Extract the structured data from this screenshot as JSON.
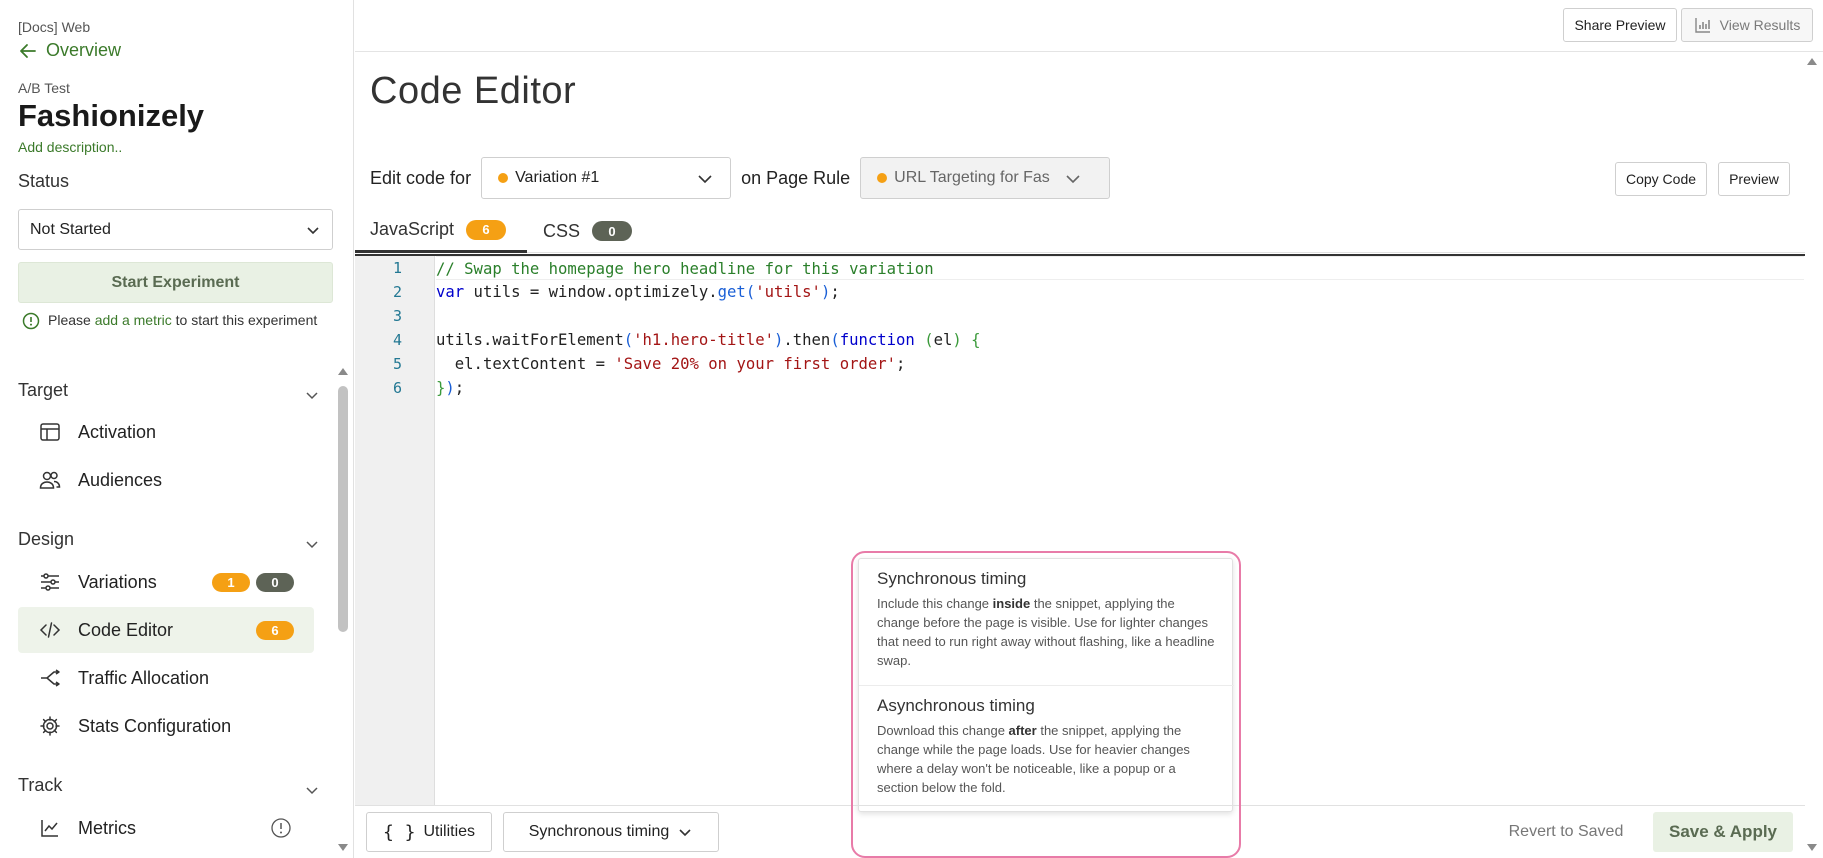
{
  "sidebar": {
    "breadcrumb": "[Docs] Web",
    "back_label": "Overview",
    "experiment_type": "A/B Test",
    "experiment_name": "Fashionizely",
    "add_description": "Add description..",
    "status_label": "Status",
    "status_value": "Not Started",
    "start_button": "Start Experiment",
    "metric_note": {
      "before": "Please ",
      "link": "add a metric",
      "after": " to start this experiment"
    },
    "sections": {
      "target": {
        "label": "Target",
        "items": [
          {
            "label": "Activation",
            "icon": "layout-icon"
          },
          {
            "label": "Audiences",
            "icon": "users-icon"
          }
        ]
      },
      "design": {
        "label": "Design",
        "items": [
          {
            "label": "Variations",
            "icon": "sliders-icon",
            "badges": [
              "1",
              "0"
            ]
          },
          {
            "label": "Code Editor",
            "icon": "code-icon",
            "badges": [
              "6"
            ]
          },
          {
            "label": "Traffic Allocation",
            "icon": "split-icon"
          },
          {
            "label": "Stats Configuration",
            "icon": "gear-icon"
          }
        ]
      },
      "track": {
        "label": "Track",
        "items": [
          {
            "label": "Metrics",
            "icon": "chart-line-icon",
            "alert": true
          }
        ]
      }
    }
  },
  "topbar": {
    "share_preview": "Share Preview",
    "view_results": "View Results"
  },
  "editor": {
    "page_title": "Code Editor",
    "edit_code_for": "Edit code for",
    "variation": "Variation #1",
    "on_page_rule": "on Page Rule",
    "page_rule": "URL Targeting for Fas",
    "copy_code": "Copy Code",
    "preview": "Preview",
    "tabs": [
      {
        "label": "JavaScript",
        "count": "6"
      },
      {
        "label": "CSS",
        "count": "0"
      }
    ],
    "line_numbers": [
      "1",
      "2",
      "3",
      "4",
      "5",
      "6"
    ]
  },
  "timing_menu": {
    "sync": {
      "title": "Synchronous timing",
      "desc_before": "Include this change ",
      "desc_bold": "inside",
      "desc_after": " the snippet, applying the change before the page is visible. Use for lighter changes that need to run right away without flashing, like a headline swap."
    },
    "async": {
      "title": "Asynchronous timing",
      "desc_before": "Download this change ",
      "desc_bold": "after",
      "desc_after": " the snippet, applying the change while the page loads. Use for heavier changes where a delay won't be noticeable, like a popup or a section below the fold."
    }
  },
  "bottombar": {
    "utilities": "Utilities",
    "timing": "Synchronous timing",
    "revert": "Revert to Saved",
    "save_apply": "Save & Apply"
  },
  "colors": {
    "accent_green": "#3b7a2a",
    "badge_orange": "#f5a014",
    "badge_dark": "#5d6356",
    "highlight_pink": "#e87ba8"
  }
}
